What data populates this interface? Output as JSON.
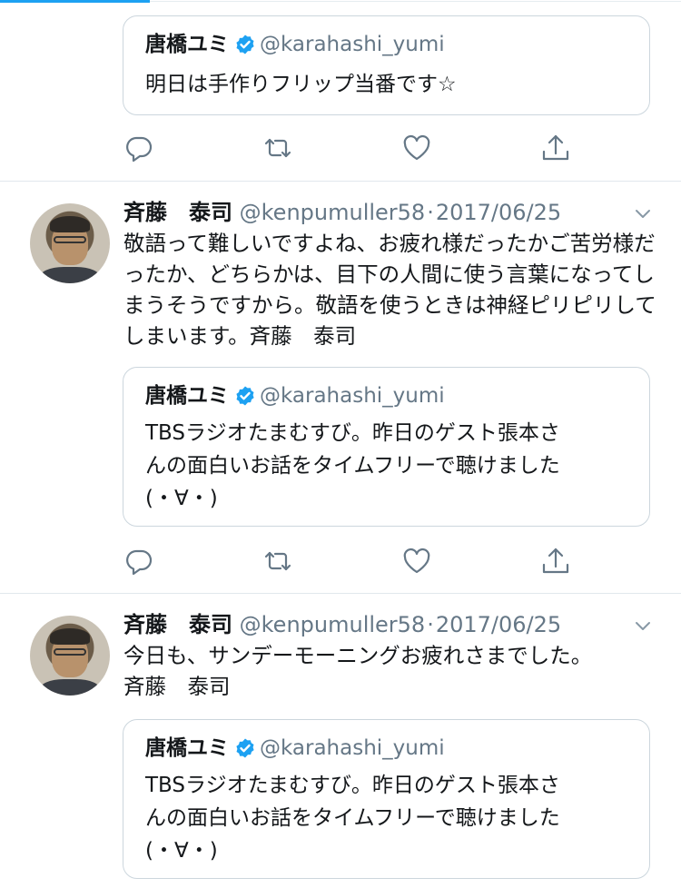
{
  "quoted_account": {
    "name": "唐橋ユミ",
    "handle": "@karahashi_yumi"
  },
  "tweets": [
    {
      "quote": {
        "text": "明日は手作りフリップ当番です☆"
      }
    },
    {
      "author_name": "斉藤　泰司",
      "author_handle": "@kenpumuller58",
      "separator": "·",
      "date": "2017/06/25",
      "text": "敬語って難しいですよね、お疲れ様だったかご苦労様だったか、どちらかは、目下の人間に使う言葉になってしまうそうですから。敬語を使うときは神経ピリピリしてしまいます。斉藤　泰司",
      "quote": {
        "text_line1": "TBSラジオたまむすび。昨日のゲスト張本さ",
        "text_line2": "んの面白いお話をタイムフリーで聴けました",
        "text_line3": "(・∀・)"
      }
    },
    {
      "author_name": "斉藤　泰司",
      "author_handle": "@kenpumuller58",
      "separator": "·",
      "date": "2017/06/25",
      "text_line1": "今日も、サンデーモーニングお疲れさまでした。",
      "text_line2": "斉藤　泰司",
      "quote": {
        "text_line1": "TBSラジオたまむすび。昨日のゲスト張本さ",
        "text_line2": "んの面白いお話をタイムフリーで聴けました",
        "text_line3": "(・∀・)"
      }
    }
  ],
  "icons": {
    "reply": "reply-icon",
    "retweet": "retweet-icon",
    "like": "heart-icon",
    "share": "share-icon",
    "verified": "verified-badge-icon",
    "menu": "chevron-down-icon"
  },
  "colors": {
    "accent": "#1da1f2",
    "secondary_text": "#657786",
    "icon_gray": "#657786",
    "border": "#ccd6dd"
  }
}
